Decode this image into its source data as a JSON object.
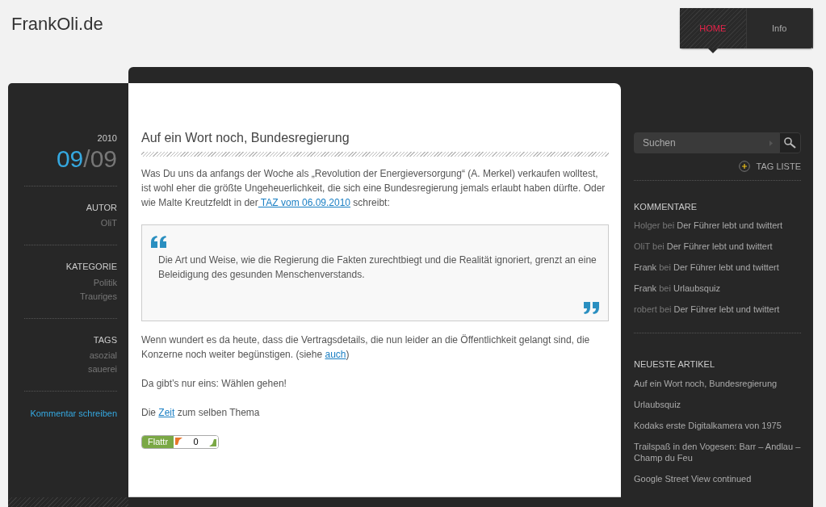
{
  "site_title": "FrankOli.de",
  "nav": [
    {
      "label": "HOME",
      "selected": true
    },
    {
      "label": "Info",
      "selected": false
    }
  ],
  "post_meta": {
    "year": "2010",
    "month": "09",
    "separator": "/",
    "day": "09",
    "sections": [
      {
        "heading": "AUTOR",
        "items": [
          "OliT"
        ]
      },
      {
        "heading": "KATEGORIE",
        "items": [
          "Politik",
          "Trauriges"
        ]
      },
      {
        "heading": "TAGS",
        "items": [
          "asozial",
          "sauerei"
        ]
      }
    ],
    "comment_link": "Kommentar schreiben"
  },
  "post": {
    "title": "Auf ein Wort noch, Bundesregierung",
    "blocks": [
      {
        "kind": "paragraph",
        "parts": [
          {
            "kind": "text",
            "text": "Was Du uns da anfangs der Woche als „Revolution der Energieversorgung“ (A. Merkel) verkaufen wolltest, ist wohl eher die größte Ungeheuerlichkeit, die sich eine Bundesregierung jemals erlaubt haben dürfte. Oder wie Malte Kreutzfeldt in der"
          },
          {
            "kind": "link",
            "text": " TAZ vom 06.09.2010"
          },
          {
            "kind": "text",
            "text": " schreibt:"
          }
        ]
      },
      {
        "kind": "quote",
        "text": "Die Art und Weise, wie die Regierung die Fakten zurechtbiegt und die Realität ignoriert, grenzt an eine Beleidigung des gesunden Menschenverstands."
      },
      {
        "kind": "paragraph",
        "parts": [
          {
            "kind": "text",
            "text": "Wenn wundert es da heute, dass die Vertragsdetails, die nun leider an die Öffentlichkeit gelangt sind, die Konzerne noch weiter begünstigen. (siehe "
          },
          {
            "kind": "link",
            "text": "auch"
          },
          {
            "kind": "text",
            "text": ")"
          }
        ]
      },
      {
        "kind": "paragraph",
        "parts": [
          {
            "kind": "text",
            "text": "Da gibt’s nur eins: Wählen gehen!"
          }
        ]
      },
      {
        "kind": "paragraph",
        "parts": [
          {
            "kind": "text",
            "text": "Die "
          },
          {
            "kind": "link",
            "text": "Zeit"
          },
          {
            "kind": "text",
            "text": " zum selben Thema"
          }
        ]
      }
    ],
    "flattr": {
      "label": "Flattr",
      "count": "0"
    }
  },
  "sidebar": {
    "search": {
      "placeholder": "Suchen"
    },
    "tag_list": "TAG LISTE",
    "comments_heading": "KOMMENTARE",
    "comments": [
      {
        "author": "Holger",
        "author_linked": false,
        "joiner": "bei",
        "post": "Der Führer lebt und twittert"
      },
      {
        "author": "OliT",
        "author_linked": false,
        "joiner": "bei",
        "post": "Der Führer lebt und twittert"
      },
      {
        "author": "Frank",
        "author_linked": true,
        "joiner": "bei",
        "post": "Der Führer lebt und twittert"
      },
      {
        "author": "Frank",
        "author_linked": true,
        "joiner": "bei",
        "post": "Urlaubsquiz"
      },
      {
        "author": "robert",
        "author_linked": false,
        "joiner": "bei",
        "post": "Der Führer lebt und twittert"
      }
    ],
    "articles_heading": "NEUESTE ARTIKEL",
    "articles": [
      "Auf ein Wort noch, Bundesregierung",
      "Urlaubsquiz",
      "Kodaks erste Digitalkamera von 1975",
      "Trailspaß in den Vogesen: Barr – Andlau – Champ du Feu",
      "Google Street View continued"
    ]
  }
}
